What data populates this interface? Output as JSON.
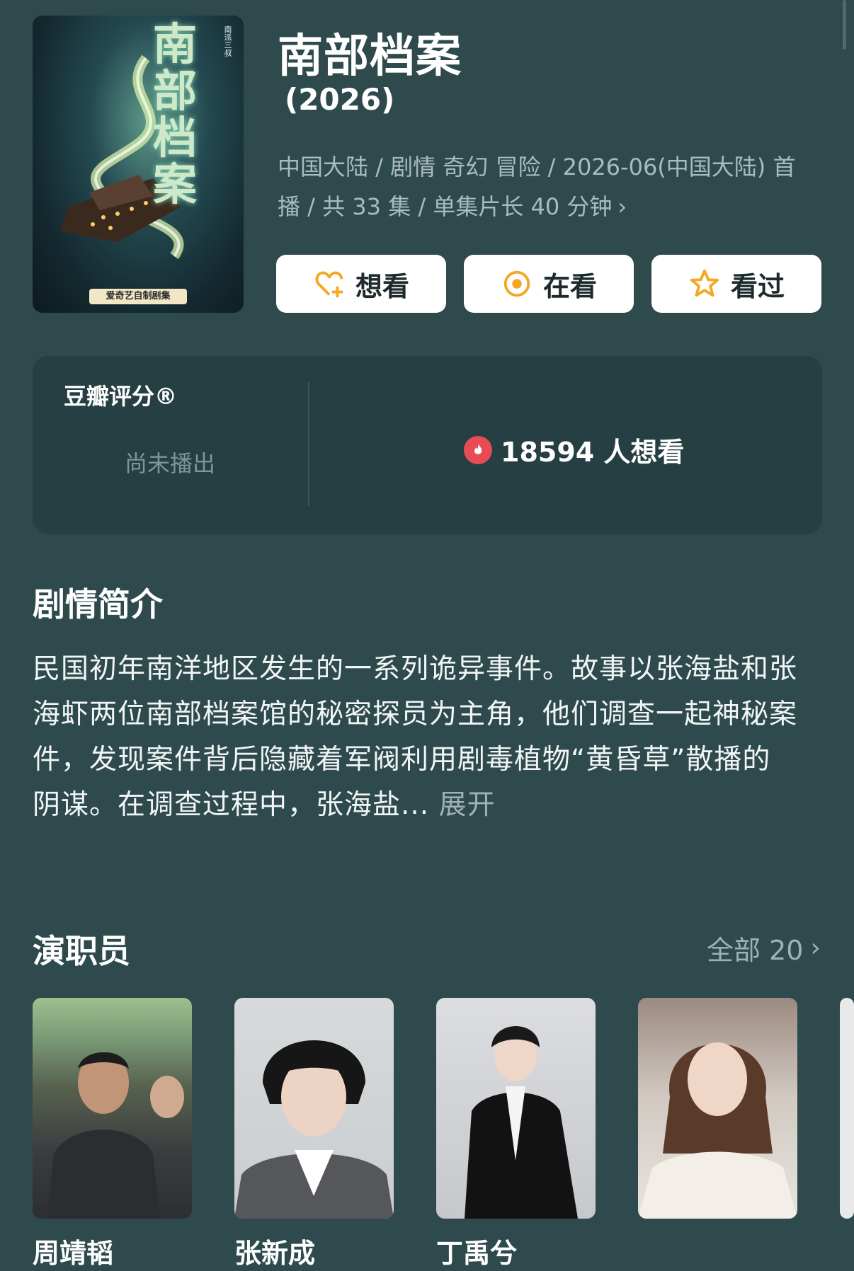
{
  "show": {
    "title": "南部档案",
    "year": "(2026)",
    "meta_line1": "中国大陆 / 剧情 奇幻 冒险 / 2026-06(中国大陆) 首",
    "meta_line2": "播 / 共 33 集 / 单集片长 40 分钟",
    "poster": {
      "title_art": "南部档案",
      "subtitle": "南派三叔",
      "badge": "爱奇艺自制剧集"
    }
  },
  "actions": {
    "want": "想看",
    "watching": "在看",
    "watched": "看过"
  },
  "rating": {
    "brand": "豆瓣评分®",
    "status": "尚未播出",
    "wish_count": "18594 人想看"
  },
  "synopsis": {
    "heading": "剧情简介",
    "text": "民国初年南洋地区发生的一系列诡异事件。故事以张海盐和张海虾两位南部档案馆的秘密探员为主角，他们调查一起神秘案件，发现案件背后隐藏着军阀利用剧毒植物“黄昏草”散播的阴谋。在调查过程中，张海盐...",
    "expand": "展开"
  },
  "cast": {
    "heading": "演职员",
    "all_label": "全部 20",
    "members": [
      {
        "name": "周靖韬"
      },
      {
        "name": "张新成"
      },
      {
        "name": "丁禹兮"
      },
      {
        "name": ""
      }
    ]
  },
  "colors": {
    "background": "#2e4a4d",
    "card": "#263f43",
    "accent": "#f5a623",
    "hot": "#e94b55"
  }
}
